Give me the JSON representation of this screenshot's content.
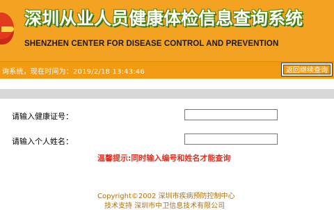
{
  "header": {
    "title_zh": "深圳从业人员健康体检信息查询系统",
    "title_en": "SHENZHEN CENTER FOR DISEASE CONTROL AND PREVENTION"
  },
  "subbar": {
    "info": "询系统，现在时间为：2019/2/18 13:43:46",
    "back_button": "返回继续查询"
  },
  "form": {
    "cert_label": "请输入健康证号：",
    "cert_value": "",
    "name_label": "请输入个人姓名：",
    "name_value": "",
    "tip": "温馨提示:同时输入编号和姓名才能查询"
  },
  "footer": {
    "copyright": "Copyright©2002  深圳市疾病预防控制中心",
    "support": "技术支持    深圳市中卫信息技术有限公司"
  },
  "colors": {
    "header_orange": "#f3a321",
    "bar_orange": "#f29a11",
    "tip_red": "#e03020"
  }
}
